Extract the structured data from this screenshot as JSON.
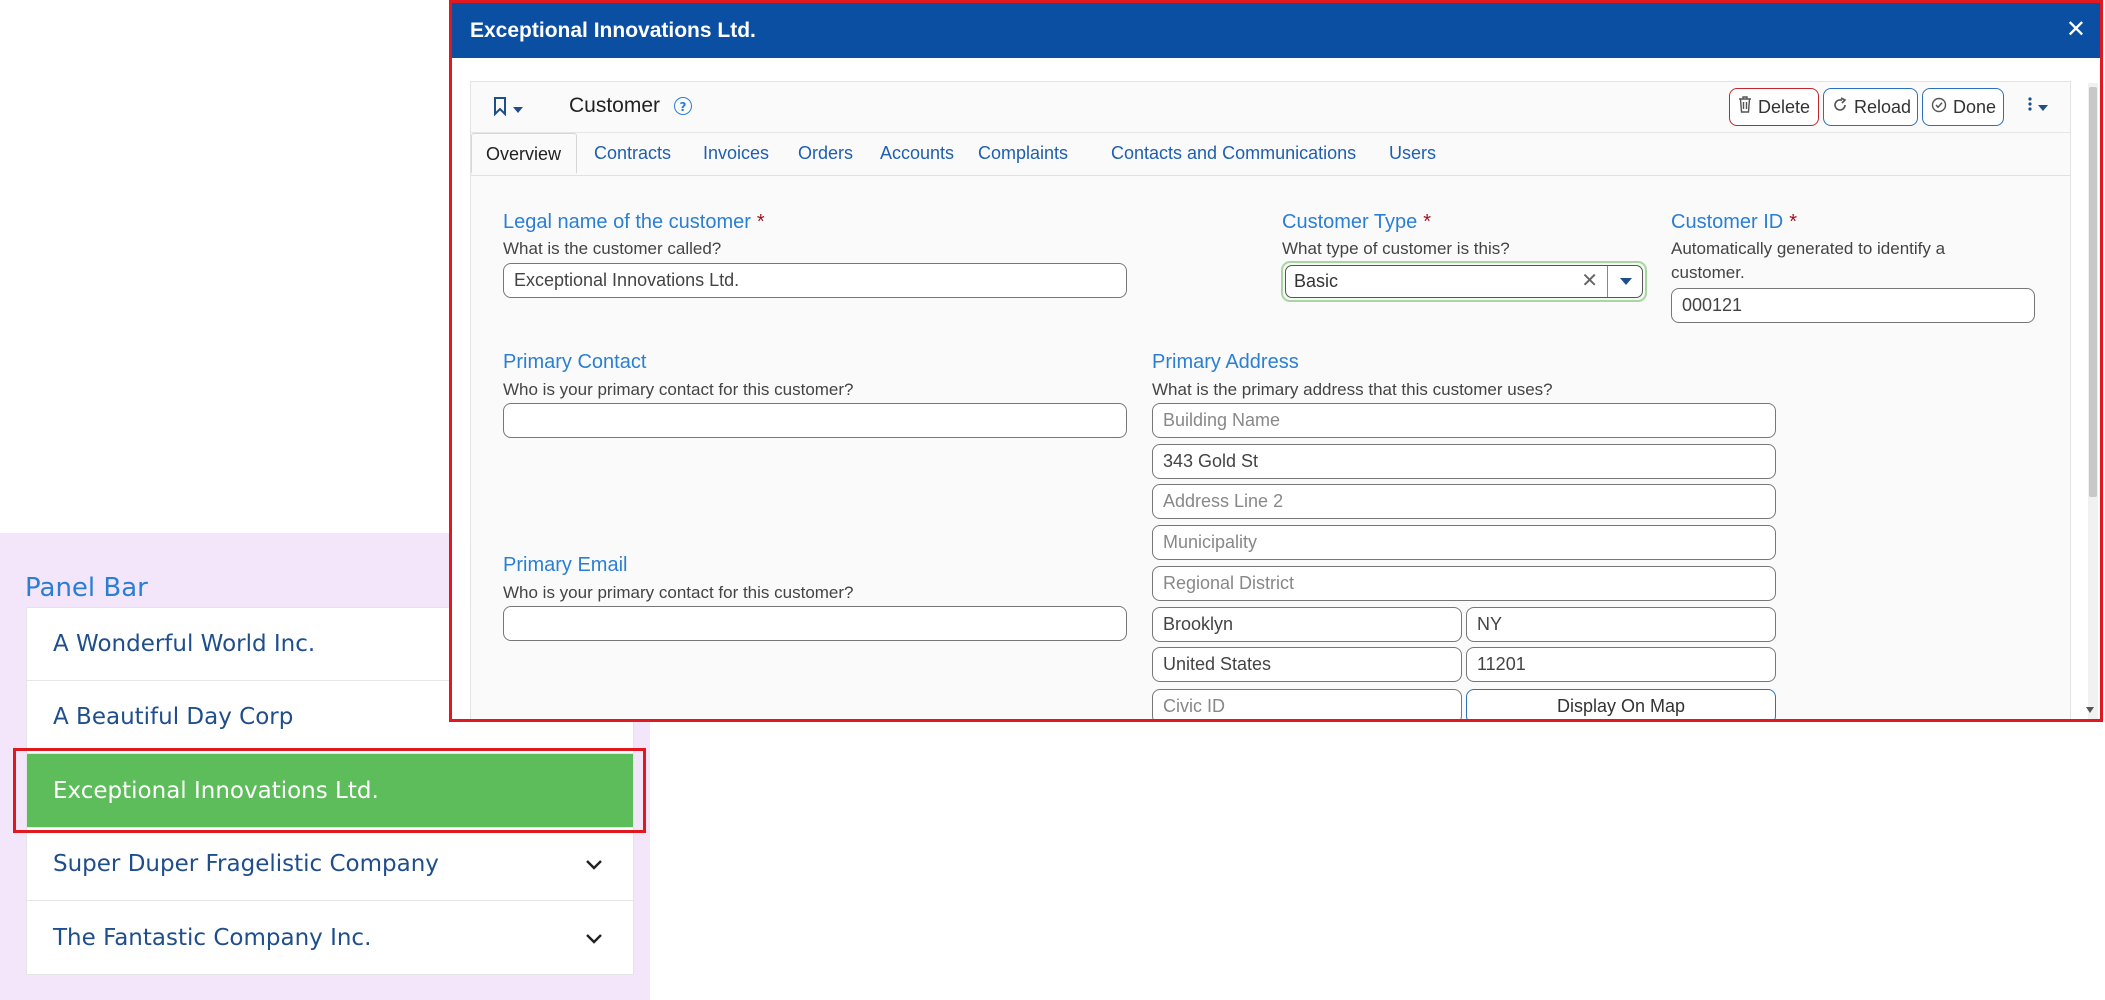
{
  "panel": {
    "title": "Panel Bar",
    "items": [
      {
        "label": "A Wonderful World Inc."
      },
      {
        "label": "A Beautiful Day Corp"
      },
      {
        "label": "Exceptional Innovations Ltd."
      },
      {
        "label": "Super Duper Fragelistic Company"
      },
      {
        "label": "The Fantastic Company Inc."
      }
    ],
    "selected_color": "#5cbd5a"
  },
  "dialog": {
    "title": "Exceptional Innovations Ltd.",
    "close_glyph": "✕",
    "header_color": "#0b4fa3"
  },
  "toolbar": {
    "form_title": "Customer",
    "help_glyph": "?",
    "delete_label": "Delete",
    "reload_label": "Reload",
    "done_label": "Done"
  },
  "tabs": [
    {
      "label": "Overview"
    },
    {
      "label": "Contracts"
    },
    {
      "label": "Invoices"
    },
    {
      "label": "Orders"
    },
    {
      "label": "Accounts"
    },
    {
      "label": "Complaints"
    },
    {
      "label": "Contacts and Communications"
    },
    {
      "label": "Users"
    }
  ],
  "form": {
    "legal_name": {
      "label": "Legal name of the customer",
      "required": "*",
      "help": "What is the customer called?",
      "value": "Exceptional Innovations Ltd."
    },
    "customer_type": {
      "label": "Customer Type",
      "required": "*",
      "help": "What type of customer is this?",
      "value": "Basic",
      "clear_glyph": "✕"
    },
    "customer_id": {
      "label": "Customer ID",
      "required": "*",
      "help_line1": "Automatically generated to identify a",
      "help_line2": "customer.",
      "value": "000121"
    },
    "primary_contact": {
      "label": "Primary Contact",
      "help": "Who is your primary contact for this customer?",
      "value": ""
    },
    "primary_email": {
      "label": "Primary Email",
      "help": "Who is your primary contact for this customer?",
      "value": ""
    },
    "primary_address": {
      "label": "Primary Address",
      "help": "What is the primary address that this customer uses?",
      "building_placeholder": "Building Name",
      "line1": "343 Gold St",
      "line2_placeholder": "Address Line 2",
      "municipality_placeholder": "Municipality",
      "regional_placeholder": "Regional District",
      "city": "Brooklyn",
      "state": "NY",
      "country": "United States",
      "postal": "11201",
      "civic_placeholder": "Civic ID",
      "map_button": "Display On Map"
    }
  },
  "icons": [
    "bookmark-icon",
    "caret-down-icon",
    "help-icon",
    "trash-icon",
    "reload-icon",
    "check-circle-icon",
    "kebab-icon",
    "chevron-down-icon",
    "close-icon"
  ]
}
